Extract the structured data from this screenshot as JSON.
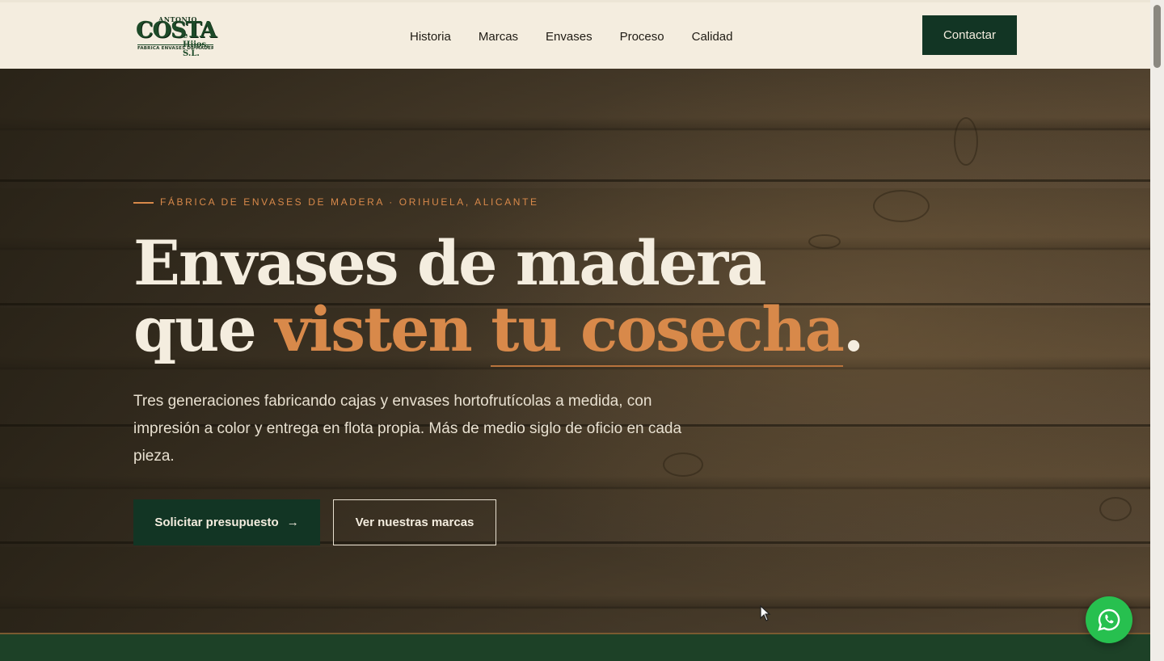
{
  "brand": {
    "logo_top": "ANTONIO",
    "logo_main": "COSTA",
    "logo_suffix": "e Hijos, S.L.",
    "logo_tagline": "FABRICA ENVASES DE MADERA"
  },
  "nav": {
    "items": [
      "Historia",
      "Marcas",
      "Envases",
      "Proceso",
      "Calidad"
    ],
    "contact_label": "Contactar"
  },
  "hero": {
    "eyebrow": "FÁBRICA DE ENVASES DE MADERA · ORIHUELA, ALICANTE",
    "headline_line1": "Envases de madera",
    "headline_line2_start": "que ",
    "headline_accent_1": "visten ",
    "headline_accent_2": "tu cosecha",
    "headline_end": ".",
    "lead": "Tres generaciones fabricando cajas y envases hortofrutícolas a medida, con impresión a color y entrega en flota propia. Más de medio siglo de oficio en cada pieza.",
    "primary_cta": "Solicitar presupuesto",
    "primary_cta_arrow": "→",
    "secondary_cta": "Ver nuestras marcas"
  },
  "colors": {
    "accent": "#d8894a",
    "brand_green": "#123524",
    "cream": "#f4eddf",
    "whatsapp": "#27c04f"
  },
  "icons": {
    "whatsapp": "whatsapp-icon",
    "cursor": "cursor-icon"
  }
}
